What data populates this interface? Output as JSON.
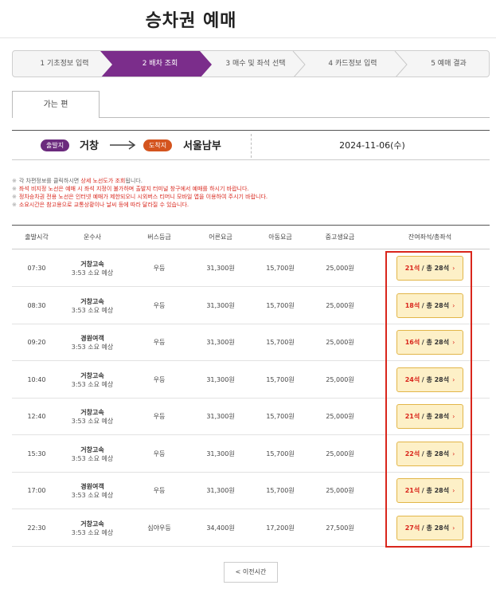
{
  "page": {
    "title": "승차권 예매"
  },
  "steps": [
    {
      "label": "1 기초정보 입력",
      "active": false
    },
    {
      "label": "2 배차 조회",
      "active": true
    },
    {
      "label": "3 매수 및 좌석 선택",
      "active": false
    },
    {
      "label": "4 카드정보 입력",
      "active": false
    },
    {
      "label": "5 예매 결과",
      "active": false
    }
  ],
  "tab": {
    "label": "가는 편"
  },
  "route": {
    "dep_badge": "출발지",
    "dep_city": "거창",
    "arr_badge": "도착지",
    "arr_city": "서울남부",
    "date": "2024-11-06(수)"
  },
  "notes": {
    "n1a": "각 차편정보를 클릭하시면 ",
    "n1b": "상세 노선도가 조회",
    "n1c": "됩니다.",
    "n2": "좌석 비지정 노선은 예매 시 좌석 지정이 불가하며 출발지 터미널 창구에서 예매를 하시기 바랍니다.",
    "n3": "정차승차권 전용 노선은 인터넷 예매가 제한되오니 시외버스 티머니 모바일 앱을 이용하여 주시기 바랍니다.",
    "n4": "소요시간은 참고용으로 교통상황이나 날씨 등에 따라 달라질 수 있습니다."
  },
  "table": {
    "headers": [
      "출발시각",
      "운수사",
      "버스등급",
      "어른요금",
      "아동요금",
      "중고생요금",
      "잔여좌석/총좌석"
    ],
    "rows": [
      {
        "time": "07:30",
        "company": "거창고속",
        "duration": "3:53 소요 예상",
        "grade": "우등",
        "adult": "31,300원",
        "child": "15,700원",
        "youth": "25,000원",
        "remain": "21석",
        "total": "/ 총 28석"
      },
      {
        "time": "08:30",
        "company": "거창고속",
        "duration": "3:53 소요 예상",
        "grade": "우등",
        "adult": "31,300원",
        "child": "15,700원",
        "youth": "25,000원",
        "remain": "18석",
        "total": "/ 총 28석"
      },
      {
        "time": "09:20",
        "company": "경원여객",
        "duration": "3:53 소요 예상",
        "grade": "우등",
        "adult": "31,300원",
        "child": "15,700원",
        "youth": "25,000원",
        "remain": "16석",
        "total": "/ 총 28석"
      },
      {
        "time": "10:40",
        "company": "거창고속",
        "duration": "3:53 소요 예상",
        "grade": "우등",
        "adult": "31,300원",
        "child": "15,700원",
        "youth": "25,000원",
        "remain": "24석",
        "total": "/ 총 28석"
      },
      {
        "time": "12:40",
        "company": "거창고속",
        "duration": "3:53 소요 예상",
        "grade": "우등",
        "adult": "31,300원",
        "child": "15,700원",
        "youth": "25,000원",
        "remain": "21석",
        "total": "/ 총 28석"
      },
      {
        "time": "15:30",
        "company": "거창고속",
        "duration": "3:53 소요 예상",
        "grade": "우등",
        "adult": "31,300원",
        "child": "15,700원",
        "youth": "25,000원",
        "remain": "22석",
        "total": "/ 총 28석"
      },
      {
        "time": "17:00",
        "company": "경원여객",
        "duration": "3:53 소요 예상",
        "grade": "우등",
        "adult": "31,300원",
        "child": "15,700원",
        "youth": "25,000원",
        "remain": "21석",
        "total": "/ 총 28석"
      },
      {
        "time": "22:30",
        "company": "거창고속",
        "duration": "3:53 소요 예상",
        "grade": "심야우등",
        "adult": "34,400원",
        "child": "17,200원",
        "youth": "27,500원",
        "remain": "27석",
        "total": "/ 총 28석"
      }
    ]
  },
  "footer": {
    "prev_label": "< 이전시간"
  },
  "colors": {
    "active_step": "#7b2d8b",
    "dep_badge": "#6b2a7d",
    "arr_badge": "#d4541e",
    "seat_bg": "#fdf0c7",
    "highlight": "#d9261c"
  }
}
